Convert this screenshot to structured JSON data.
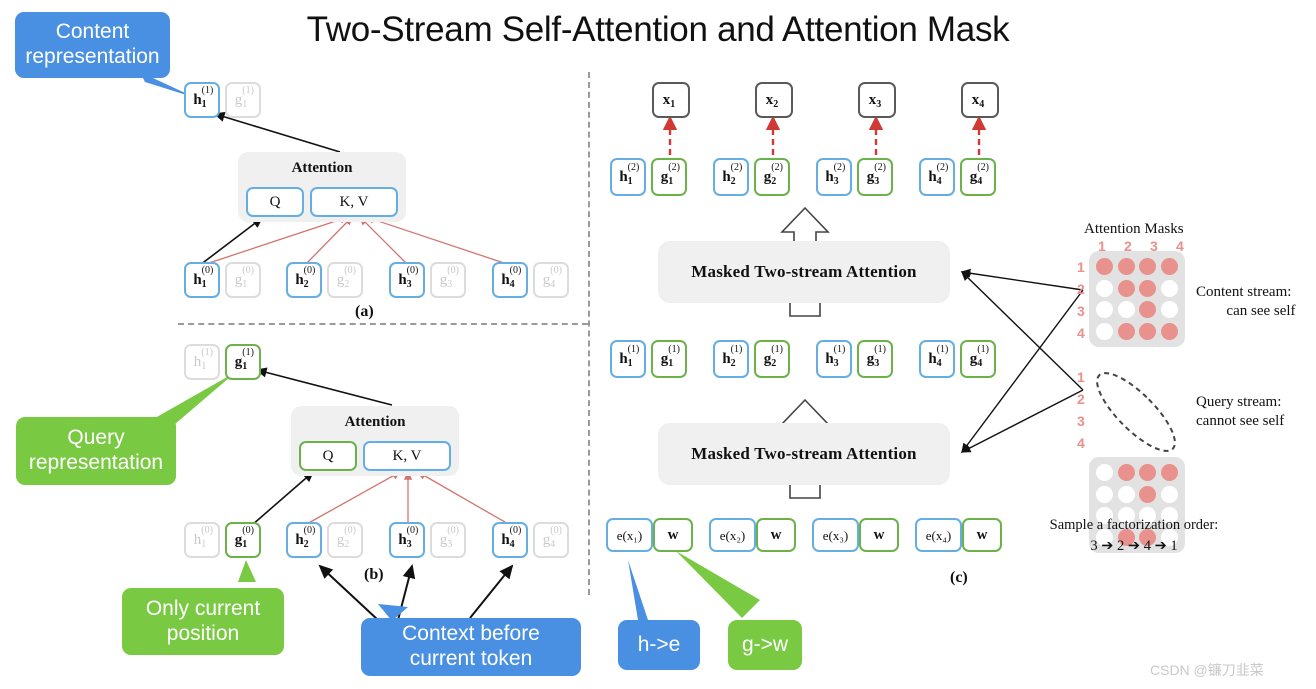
{
  "title": "Two-Stream Self-Attention and Attention Mask",
  "watermark": "CSDN @镰刀韭菜",
  "callouts": {
    "content_representation": "Content\nrepresentation",
    "query_representation": "Query\nrepresentation",
    "only_current_position": "Only current\nposition",
    "context_before_current_token": "Context before\ncurrent token",
    "h_to_e": "h->e",
    "g_to_w": "g->w"
  },
  "panel_a": {
    "letter": "(a)",
    "attention_label": "Attention",
    "q_label": "Q",
    "kv_label": "K, V",
    "top_cells": [
      {
        "sym": "h",
        "sup": "(1)",
        "sub": "1",
        "state": "active-h"
      },
      {
        "sym": "g",
        "sup": "(1)",
        "sub": "1",
        "state": "dim"
      }
    ],
    "bottom_cells": [
      {
        "sym": "h",
        "sup": "(0)",
        "sub": "1",
        "state": "active-h"
      },
      {
        "sym": "g",
        "sup": "(0)",
        "sub": "1",
        "state": "dim"
      },
      {
        "sym": "h",
        "sup": "(0)",
        "sub": "2",
        "state": "active-h"
      },
      {
        "sym": "g",
        "sup": "(0)",
        "sub": "2",
        "state": "dim"
      },
      {
        "sym": "h",
        "sup": "(0)",
        "sub": "3",
        "state": "active-h"
      },
      {
        "sym": "g",
        "sup": "(0)",
        "sub": "3",
        "state": "dim"
      },
      {
        "sym": "h",
        "sup": "(0)",
        "sub": "4",
        "state": "active-h"
      },
      {
        "sym": "g",
        "sup": "(0)",
        "sub": "4",
        "state": "dim"
      }
    ]
  },
  "panel_b": {
    "letter": "(b)",
    "attention_label": "Attention",
    "q_label": "Q",
    "kv_label": "K, V",
    "top_cells": [
      {
        "sym": "h",
        "sup": "(1)",
        "sub": "1",
        "state": "dim"
      },
      {
        "sym": "g",
        "sup": "(1)",
        "sub": "1",
        "state": "active-g"
      }
    ],
    "bottom_cells": [
      {
        "sym": "h",
        "sup": "(0)",
        "sub": "1",
        "state": "dim"
      },
      {
        "sym": "g",
        "sup": "(0)",
        "sub": "1",
        "state": "active-g"
      },
      {
        "sym": "h",
        "sup": "(0)",
        "sub": "2",
        "state": "active-h"
      },
      {
        "sym": "g",
        "sup": "(0)",
        "sub": "2",
        "state": "dim"
      },
      {
        "sym": "h",
        "sup": "(0)",
        "sub": "3",
        "state": "active-h"
      },
      {
        "sym": "g",
        "sup": "(0)",
        "sub": "3",
        "state": "dim"
      },
      {
        "sym": "h",
        "sup": "(0)",
        "sub": "4",
        "state": "active-h"
      },
      {
        "sym": "g",
        "sup": "(0)",
        "sub": "4",
        "state": "dim"
      }
    ]
  },
  "panel_c": {
    "letter": "(c)",
    "attention_block_label": "Masked Two-stream Attention",
    "x_tokens": [
      {
        "sym": "x",
        "sub": "1"
      },
      {
        "sym": "x",
        "sub": "2"
      },
      {
        "sym": "x",
        "sub": "3"
      },
      {
        "sym": "x",
        "sub": "4"
      }
    ],
    "layer2": [
      {
        "sym": "h",
        "sup": "(2)",
        "sub": "1"
      },
      {
        "sym": "g",
        "sup": "(2)",
        "sub": "1"
      },
      {
        "sym": "h",
        "sup": "(2)",
        "sub": "2"
      },
      {
        "sym": "g",
        "sup": "(2)",
        "sub": "2"
      },
      {
        "sym": "h",
        "sup": "(2)",
        "sub": "3"
      },
      {
        "sym": "g",
        "sup": "(2)",
        "sub": "3"
      },
      {
        "sym": "h",
        "sup": "(2)",
        "sub": "4"
      },
      {
        "sym": "g",
        "sup": "(2)",
        "sub": "4"
      }
    ],
    "layer1": [
      {
        "sym": "h",
        "sup": "(1)",
        "sub": "1"
      },
      {
        "sym": "g",
        "sup": "(1)",
        "sub": "1"
      },
      {
        "sym": "h",
        "sup": "(1)",
        "sub": "2"
      },
      {
        "sym": "g",
        "sup": "(1)",
        "sub": "2"
      },
      {
        "sym": "h",
        "sup": "(1)",
        "sub": "3"
      },
      {
        "sym": "g",
        "sup": "(1)",
        "sub": "3"
      },
      {
        "sym": "h",
        "sup": "(1)",
        "sub": "4"
      },
      {
        "sym": "g",
        "sup": "(1)",
        "sub": "4"
      }
    ],
    "embeddings": [
      {
        "label": "e(x₁)",
        "kind": "h"
      },
      {
        "label": "w",
        "kind": "g"
      },
      {
        "label": "e(x₂)",
        "kind": "h"
      },
      {
        "label": "w",
        "kind": "g"
      },
      {
        "label": "e(x₃)",
        "kind": "h"
      },
      {
        "label": "w",
        "kind": "g"
      },
      {
        "label": "e(x₄)",
        "kind": "h"
      },
      {
        "label": "w",
        "kind": "g"
      }
    ]
  },
  "masks": {
    "title": "Attention Masks",
    "col_labels": [
      "1",
      "2",
      "3",
      "4"
    ],
    "row_labels": [
      "1",
      "2",
      "3",
      "4"
    ],
    "content": {
      "caption_line1": "Content stream:",
      "caption_line2": "can see self",
      "matrix": [
        [
          1,
          1,
          1,
          1
        ],
        [
          0,
          1,
          1,
          0
        ],
        [
          0,
          0,
          1,
          0
        ],
        [
          0,
          1,
          1,
          1
        ]
      ]
    },
    "query": {
      "caption_line1": "Query stream:",
      "caption_line2": "cannot see self",
      "matrix": [
        [
          0,
          1,
          1,
          1
        ],
        [
          0,
          0,
          1,
          0
        ],
        [
          0,
          0,
          0,
          0
        ],
        [
          0,
          1,
          1,
          0
        ]
      ]
    },
    "factorization_line1": "Sample a factorization  order:",
    "factorization_line2": "3 ➔ 2 ➔ 4 ➔ 1"
  },
  "colors": {
    "content_blue": "#4a90e2",
    "query_green": "#7ac943",
    "h_border": "#64aee3",
    "g_border": "#6cb24b",
    "dim_border": "#dcdcdc",
    "mask_on": "#e8918d",
    "mask_bg": "#e2e2e2",
    "attention_bg": "#f0f0f0",
    "red_arrow": "#d4736e"
  }
}
